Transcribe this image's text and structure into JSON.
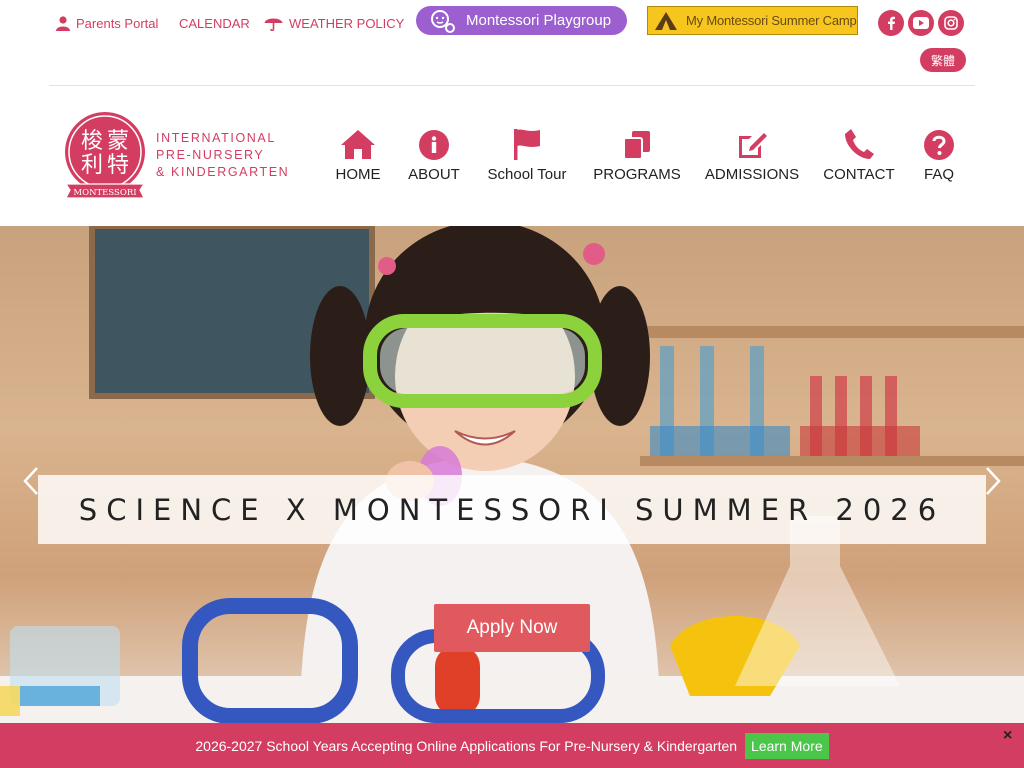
{
  "topbar": {
    "parents_portal": "Parents Portal",
    "calendar": "CALENDAR",
    "weather_policy": "WEATHER POLICY",
    "playgroup": "Montessori Playgroup",
    "summer_camp": "My Montessori Summer Camp",
    "language": "繁體"
  },
  "brand": {
    "logo_chars": [
      "蒙",
      "特",
      "梭",
      "利"
    ],
    "logo_banner": "MONTESSORI",
    "name_lines": [
      "INTERNATIONAL",
      "PRE-NURSERY",
      "& KINDERGARTEN"
    ]
  },
  "nav": {
    "home": "HOME",
    "about": "ABOUT",
    "school_tour": "School Tour",
    "programs": "PROGRAMS",
    "admissions": "ADMISSIONS",
    "contact": "CONTACT",
    "faq": "FAQ"
  },
  "hero": {
    "caption": "SCIENCE X MONTESSORI SUMMER 2026",
    "apply_label": "Apply Now"
  },
  "banner": {
    "text": "2026-2027 School Years Accepting Online Applications For Pre-Nursery & Kindergarten",
    "learn_more": "Learn More",
    "close": "×"
  },
  "colors": {
    "brand_pink": "#d43d62",
    "playgroup_purple": "#9c5fcf",
    "camp_yellow": "#f7c61e",
    "apply_red": "#e0595f",
    "learn_green": "#4cc64a"
  },
  "icons": [
    "user-icon",
    "umbrella-icon",
    "facebook-icon",
    "youtube-icon",
    "instagram-icon",
    "home-icon",
    "info-icon",
    "flag-icon",
    "copy-icon",
    "edit-icon",
    "phone-icon",
    "question-icon",
    "chevron-left-icon",
    "chevron-right-icon",
    "close-icon"
  ]
}
